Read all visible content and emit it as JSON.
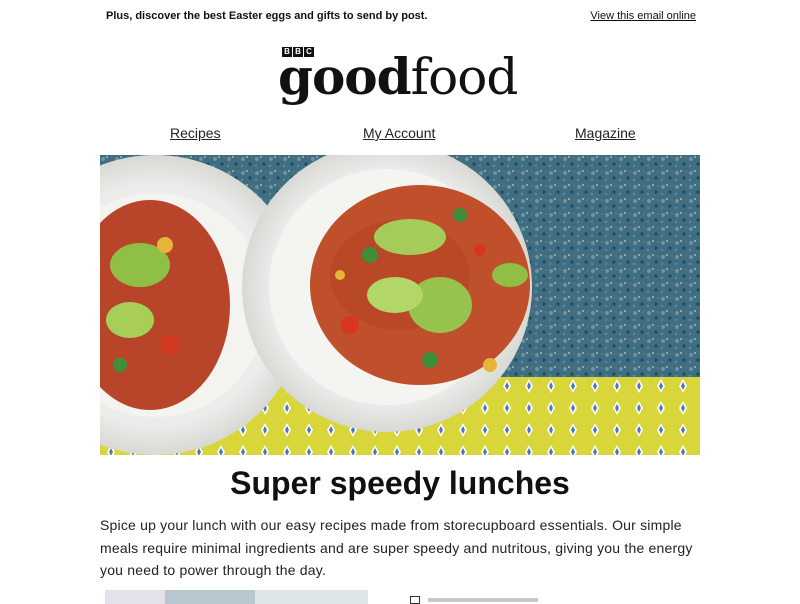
{
  "preheader": {
    "text": "Plus, discover the best Easter eggs and gifts to send by post.",
    "view_online": "View this email online"
  },
  "logo": {
    "bbc": [
      "B",
      "B",
      "C"
    ],
    "good": "good",
    "food": "food"
  },
  "nav": {
    "items": [
      "Recipes",
      "My Account",
      "Magazine"
    ]
  },
  "hero": {
    "alt": "Two plates of penne pasta with tomato, avocado and coriander on a speckled blue surface"
  },
  "article": {
    "title": "Super speedy lunches",
    "body": "Spice up your lunch with our easy recipes made from storecupboard essentials. Our simple meals require minimal ingredients and are super speedy and nutritous, giving you the energy you need to power through the day."
  },
  "colors": {
    "text": "#111111",
    "link": "#222222",
    "background": "#ffffff",
    "cloth": "#d6d43c",
    "surface": "#3e6a80"
  }
}
